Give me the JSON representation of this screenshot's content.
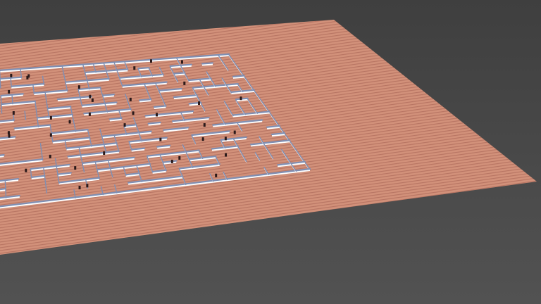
{
  "scene": {
    "background_top": "#3f3f3f",
    "background_bottom": "#525252",
    "floor_color": "#d2917a",
    "floor_stripe_color": "#b87563",
    "wall_top_color": "#7f8fb3",
    "wall_side_color": "#ffffff",
    "agent_color": "#2b1a1a",
    "grid_cols": 24,
    "grid_rows": 16
  }
}
